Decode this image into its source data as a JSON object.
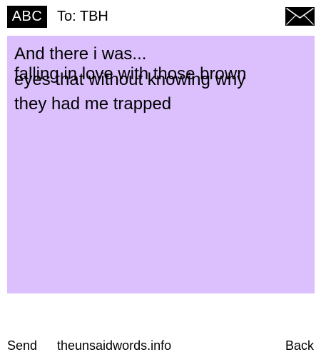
{
  "header": {
    "badge_label": "ABC",
    "recipient_label": "To: TBH",
    "mail_icon": "envelope-icon"
  },
  "note": {
    "background_color": "#dbc0fd",
    "lines": [
      "And there i was...",
      "falling in love with those brown",
      "eyes that without knowing why",
      "they had me trapped"
    ]
  },
  "footer": {
    "send_label": "Send",
    "site_label": "theunsaidwords.info",
    "back_label": "Back"
  }
}
